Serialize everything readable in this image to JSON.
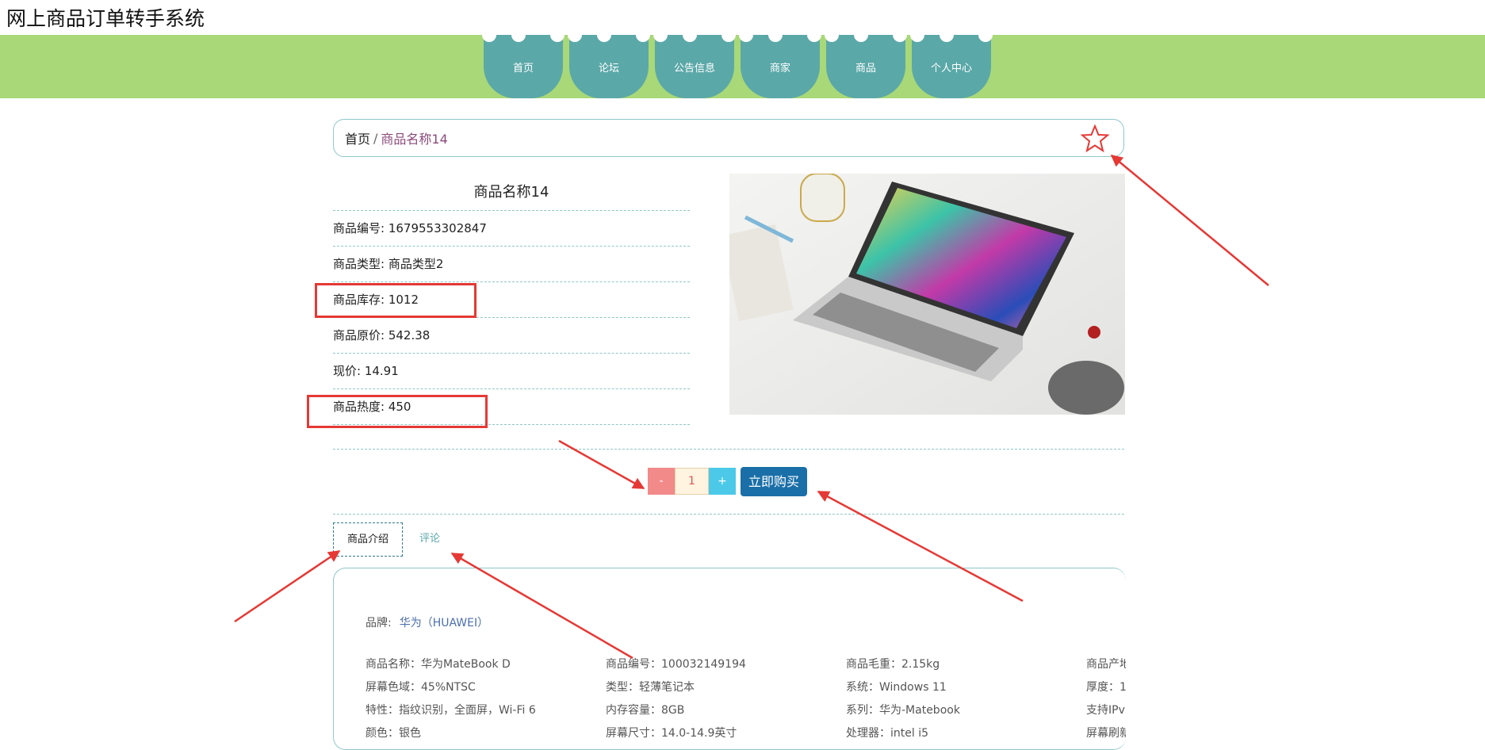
{
  "app": {
    "title": "网上商品订单转手系统"
  },
  "nav": {
    "items": [
      "首页",
      "论坛",
      "公告信息",
      "商家",
      "商品",
      "个人中心"
    ]
  },
  "breadcrumb": {
    "home": "首页",
    "separator": "/",
    "current": "商品名称14"
  },
  "product": {
    "title": "商品名称14",
    "fields": [
      "商品编号: 1679553302847",
      "商品类型: 商品类型2",
      "商品库存: 1012",
      "商品原价: 542.38",
      "现价: 14.91",
      "商品热度: 450"
    ]
  },
  "purchase": {
    "minus": "-",
    "quantity": "1",
    "plus": "+",
    "buy_label": "立即购买"
  },
  "tabs": {
    "intro": "商品介绍",
    "comments": "评论"
  },
  "details": {
    "brand_label": "品牌:",
    "brand_value": "华为（HUAWEI）",
    "specs": [
      "商品名称：华为MateBook D",
      "商品编号：100032149194",
      "商品毛重：2.15kg",
      "商品产地",
      "屏幕色域：45%NTSC",
      "类型：轻薄笔记本",
      "系统：Windows 11",
      "厚度：1",
      "特性：指纹识别，全面屏，Wi-Fi 6",
      "内存容量：8GB",
      "系列：华为-Matebook",
      "支持IPv",
      "颜色：银色",
      "屏幕尺寸：14.0-14.9英寸",
      "处理器：intel i5",
      "屏幕刷新"
    ]
  },
  "colors": {
    "nav_bg": "#a8d878",
    "nav_item": "#5ba8a8",
    "annotation": "#e53935",
    "buy": "#1a6fa8"
  }
}
